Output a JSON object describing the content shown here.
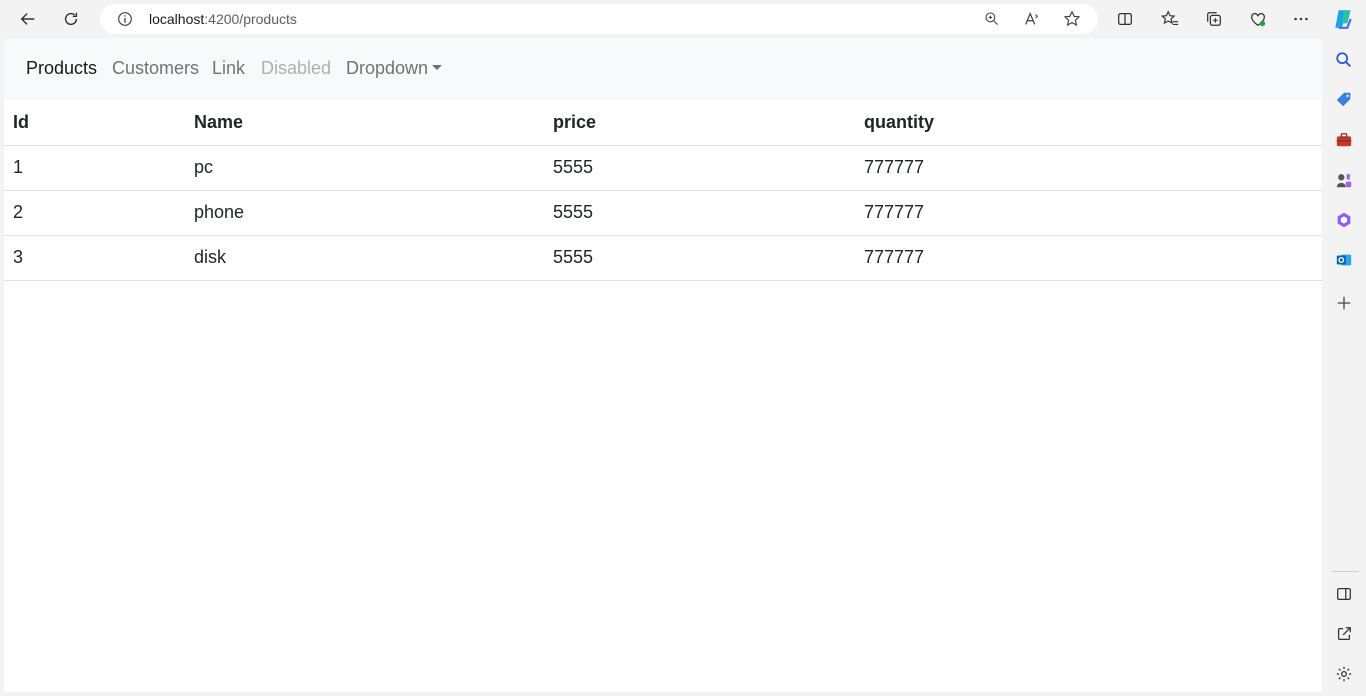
{
  "browser": {
    "url_host": "localhost",
    "url_path": ":4200/products",
    "icons": [
      "back-arrow-icon",
      "refresh-icon",
      "info-icon",
      "zoom-icon",
      "read-aloud-icon",
      "favorite-star-icon",
      "split-screen-icon",
      "favorites-icon",
      "collections-icon",
      "browser-essentials-icon",
      "more-icon",
      "copilot-icon"
    ],
    "sidebar_icons": [
      "search-icon",
      "shopping-tag-icon",
      "tools-icon",
      "games-icon",
      "office-icon",
      "outlook-icon",
      "add-icon",
      "sidebar-toggle-icon",
      "external-link-icon",
      "settings-icon"
    ]
  },
  "nav": {
    "products": "Products",
    "customers": "Customers",
    "link": "Link",
    "disabled": "Disabled",
    "dropdown": "Dropdown"
  },
  "table": {
    "headers": [
      "Id",
      "Name",
      "price",
      "quantity"
    ],
    "rows": [
      [
        "1",
        "pc",
        "5555",
        "777777"
      ],
      [
        "2",
        "phone",
        "5555",
        "777777"
      ],
      [
        "3",
        "disk",
        "5555",
        "777777"
      ]
    ]
  }
}
